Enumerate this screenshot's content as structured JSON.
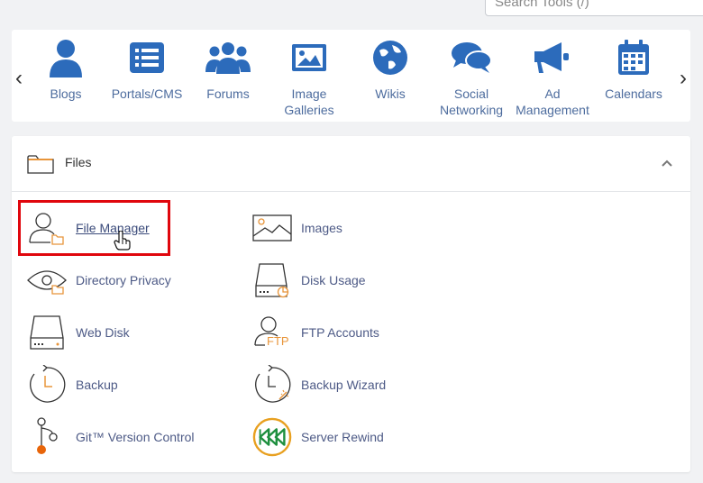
{
  "search": {
    "placeholder": "Search Tools (/)"
  },
  "carousel": {
    "prev": "‹",
    "next": "›",
    "items": [
      {
        "label": "Blogs",
        "icon": "user-icon"
      },
      {
        "label": "Portals/CMS",
        "icon": "list-icon"
      },
      {
        "label": "Forums",
        "icon": "users-icon"
      },
      {
        "label": "Image Galleries",
        "icon": "image-icon"
      },
      {
        "label": "Wikis",
        "icon": "globe-icon"
      },
      {
        "label": "Social Networking",
        "icon": "chat-bubbles-icon"
      },
      {
        "label": "Ad Management",
        "icon": "megaphone-icon"
      },
      {
        "label": "Calendars",
        "icon": "calendar-icon"
      }
    ]
  },
  "files": {
    "title": "Files",
    "collapse": "^",
    "tools": [
      {
        "label": "File Manager",
        "icon": "file-manager-icon"
      },
      {
        "label": "Images",
        "icon": "images-icon"
      },
      {
        "label": "Directory Privacy",
        "icon": "directory-privacy-icon"
      },
      {
        "label": "Disk Usage",
        "icon": "disk-usage-icon"
      },
      {
        "label": "Web Disk",
        "icon": "web-disk-icon"
      },
      {
        "label": "FTP Accounts",
        "icon": "ftp-accounts-icon"
      },
      {
        "label": "Backup",
        "icon": "backup-icon"
      },
      {
        "label": "Backup Wizard",
        "icon": "backup-wizard-icon"
      },
      {
        "label": "Git™ Version Control",
        "icon": "git-icon"
      },
      {
        "label": "Server Rewind",
        "icon": "server-rewind-icon"
      }
    ],
    "ftp_badge": "FTP"
  },
  "colors": {
    "blue_icon": "#2c6bbb",
    "orange_accent": "#e8953a",
    "highlight": "#e0060d",
    "green": "#1e8f3e"
  }
}
